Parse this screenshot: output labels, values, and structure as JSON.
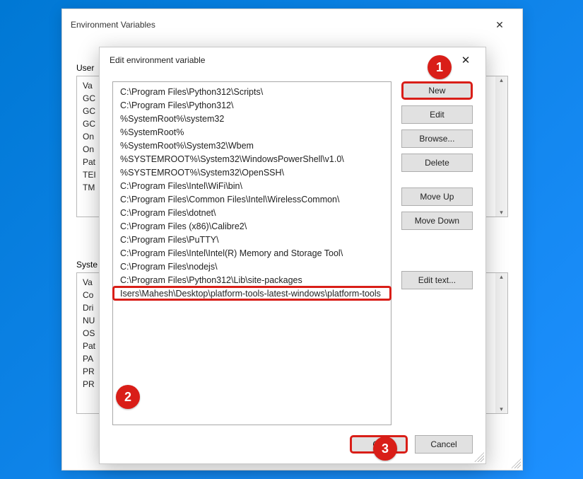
{
  "back_dialog": {
    "title": "Environment Variables",
    "user_section_label": "User",
    "user_rows": [
      "Va",
      "GC",
      "GC",
      "GC",
      "On",
      "On",
      "Pat",
      "TEI",
      "TM"
    ],
    "sys_section_label": "Syste",
    "sys_rows": [
      "Va",
      "Co",
      "Dri",
      "NU",
      "OS",
      "Pat",
      "PA",
      "PR",
      "PR"
    ]
  },
  "front_dialog": {
    "title": "Edit environment variable",
    "paths": [
      "C:\\Program Files\\Python312\\Scripts\\",
      "C:\\Program Files\\Python312\\",
      "%SystemRoot%\\system32",
      "%SystemRoot%",
      "%SystemRoot%\\System32\\Wbem",
      "%SYSTEMROOT%\\System32\\WindowsPowerShell\\v1.0\\",
      "%SYSTEMROOT%\\System32\\OpenSSH\\",
      "C:\\Program Files\\Intel\\WiFi\\bin\\",
      "C:\\Program Files\\Common Files\\Intel\\WirelessCommon\\",
      "C:\\Program Files\\dotnet\\",
      "C:\\Program Files (x86)\\Calibre2\\",
      "C:\\Program Files\\PuTTY\\",
      "C:\\Program Files\\Intel\\Intel(R) Memory and Storage Tool\\",
      "C:\\Program Files\\nodejs\\",
      "C:\\Program Files\\Python312\\Lib\\site-packages",
      "Isers\\Mahesh\\Desktop\\platform-tools-latest-windows\\platform-tools"
    ],
    "selected_index": 15,
    "buttons": {
      "new": "New",
      "edit": "Edit",
      "browse": "Browse...",
      "delete": "Delete",
      "move_up": "Move Up",
      "move_down": "Move Down",
      "edit_text": "Edit text...",
      "ok": "OK",
      "cancel": "Cancel"
    }
  },
  "annotations": {
    "step1": "1",
    "step2": "2",
    "step3": "3"
  }
}
